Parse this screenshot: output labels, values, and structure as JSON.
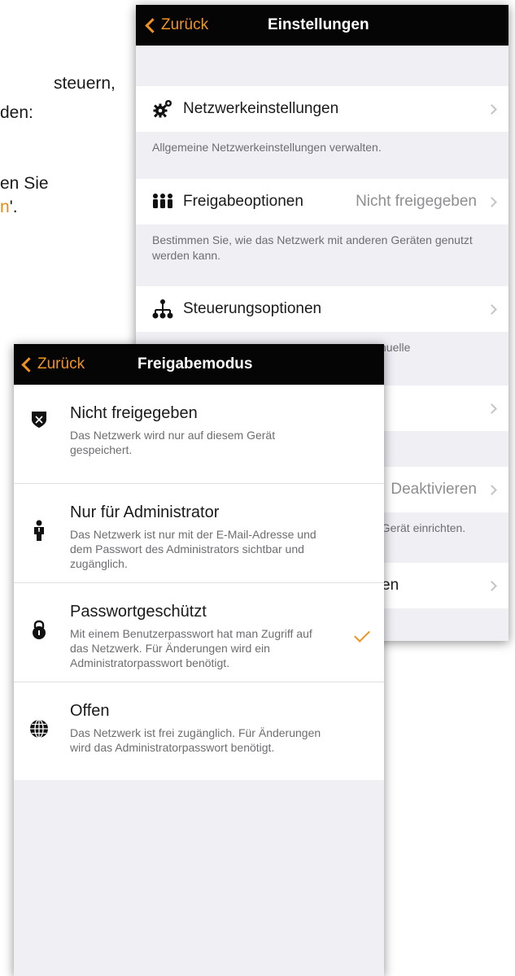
{
  "doc": {
    "line1": "steuern,",
    "line2": "den:",
    "line3": "en Sie",
    "line4_orange": "n",
    "line4_rest": "'."
  },
  "settings": {
    "back_label": "Zurück",
    "title": "Einstellungen",
    "rows": [
      {
        "icon": "gear-icon",
        "label": "Netzwerkeinstellungen",
        "value": "",
        "footer": "Allgemeine Netzwerkeinstellungen verwalten."
      },
      {
        "icon": "people-icon",
        "label": "Freigabeoptionen",
        "value": "Nicht freigegeben",
        "footer": "Bestimmen Sie, wie das Netzwerk mit anderen Geräten genutzt werden kann."
      },
      {
        "icon": "hierarchy-icon",
        "label": "Steuerungsoptionen",
        "value": "",
        "footer": "nuelle"
      }
    ],
    "row4_value": "Deaktivieren",
    "row4_footer": "n Gerät einrichten.",
    "row5_label": "en"
  },
  "sharing_mode": {
    "back_label": "Zurück",
    "title": "Freigabemodus",
    "options": [
      {
        "icon": "shield-icon",
        "title": "Nicht freigegeben",
        "description": "Das Netzwerk wird nur auf diesem Gerät gespeichert.",
        "selected": false
      },
      {
        "icon": "person-icon",
        "title": "Nur für Administrator",
        "description": "Das Netzwerk ist nur mit der E-Mail-Adresse und dem Passwort des Administrators sichtbar und zugänglich.",
        "selected": false
      },
      {
        "icon": "lock-icon",
        "title": "Passwortgeschützt",
        "description": "Mit einem Benutzerpasswort hat man Zugriff auf das Netzwerk. Für Änderungen wird ein Administratorpasswort benötigt.",
        "selected": true
      },
      {
        "icon": "globe-icon",
        "title": "Offen",
        "description": "Das Netzwerk ist frei zugänglich. Für Änderungen wird das Administratorpasswort benötigt.",
        "selected": false
      }
    ]
  },
  "colors": {
    "accent": "#f0941e",
    "navbar": "#050505",
    "background": "#efeff4"
  }
}
